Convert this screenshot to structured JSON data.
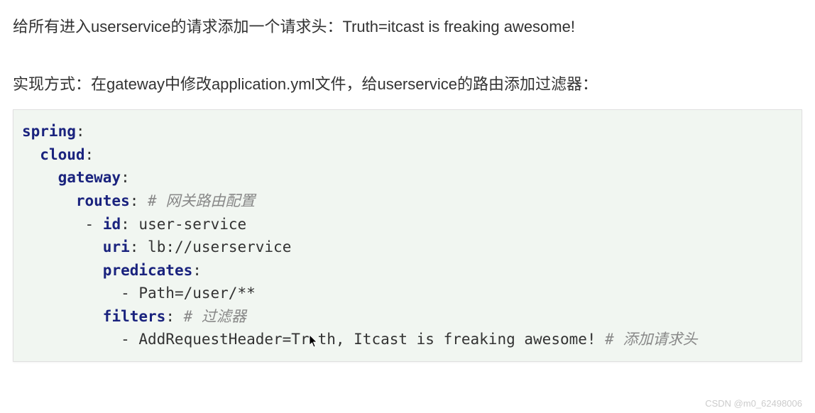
{
  "heading": "给所有进入userservice的请求添加一个请求头：Truth=itcast is freaking awesome!",
  "sub_heading": "实现方式：在gateway中修改application.yml文件，给userservice的路由添加过滤器：",
  "code": {
    "spring": "spring",
    "cloud": "cloud",
    "gateway": "gateway",
    "routes": "routes",
    "routes_comment": "# 网关路由配置",
    "id_key": "id",
    "id_val": "user-service",
    "uri_key": "uri",
    "uri_val": "lb://userservice",
    "predicates_key": "predicates",
    "path_val": "Path=/user/**",
    "filters_key": "filters",
    "filters_comment": "# 过滤器",
    "filter_line_prefix": "- AddRequestHeader=Tr",
    "filter_line_suffix": "th, Itcast is freaking awesome! ",
    "filter_comment": "# 添加请求头",
    "colon": ":",
    "dash": "- "
  },
  "watermark": "CSDN @m0_62498006"
}
